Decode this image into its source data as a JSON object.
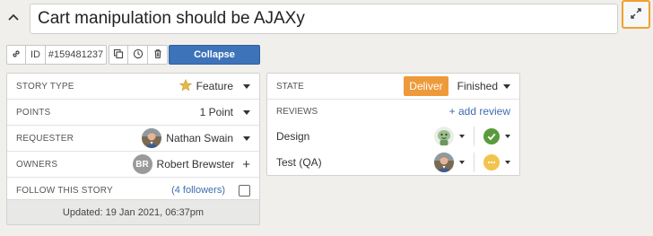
{
  "header": {
    "title": "Cart manipulation should be AJAXy"
  },
  "toolbar": {
    "id_label": "ID",
    "story_id": "#159481237",
    "collapse_label": "Collapse"
  },
  "details": {
    "story_type": {
      "label": "STORY TYPE",
      "value": "Feature"
    },
    "points": {
      "label": "POINTS",
      "value": "1 Point"
    },
    "requester": {
      "label": "REQUESTER",
      "value": "Nathan Swain"
    },
    "owners": {
      "label": "OWNERS",
      "value": "Robert Brewster",
      "initials": "BR",
      "add_symbol": "+"
    },
    "follow": {
      "label": "FOLLOW THIS STORY",
      "followers": "(4 followers)"
    },
    "updated": "Updated: 19 Jan 2021, 06:37pm"
  },
  "state": {
    "label": "STATE",
    "deliver_label": "Deliver",
    "current": "Finished"
  },
  "reviews": {
    "label": "REVIEWS",
    "add_label": "+ add review",
    "items": [
      {
        "name": "Design",
        "status": "passed"
      },
      {
        "name": "Test (QA)",
        "status": "pending"
      }
    ]
  },
  "colors": {
    "accent_blue": "#3d73b9",
    "deliver_orange": "#ee9a3a",
    "pass_green": "#5a9a3c",
    "pending_yellow": "#f2c34d",
    "focus_orange": "#f0a030"
  },
  "icons": {
    "chevron": "chevron-up-icon",
    "expand": "expand-icon",
    "link": "link-icon",
    "clone": "clone-icon",
    "history": "history-icon",
    "delete": "trash-icon",
    "story_type": "star-icon"
  }
}
